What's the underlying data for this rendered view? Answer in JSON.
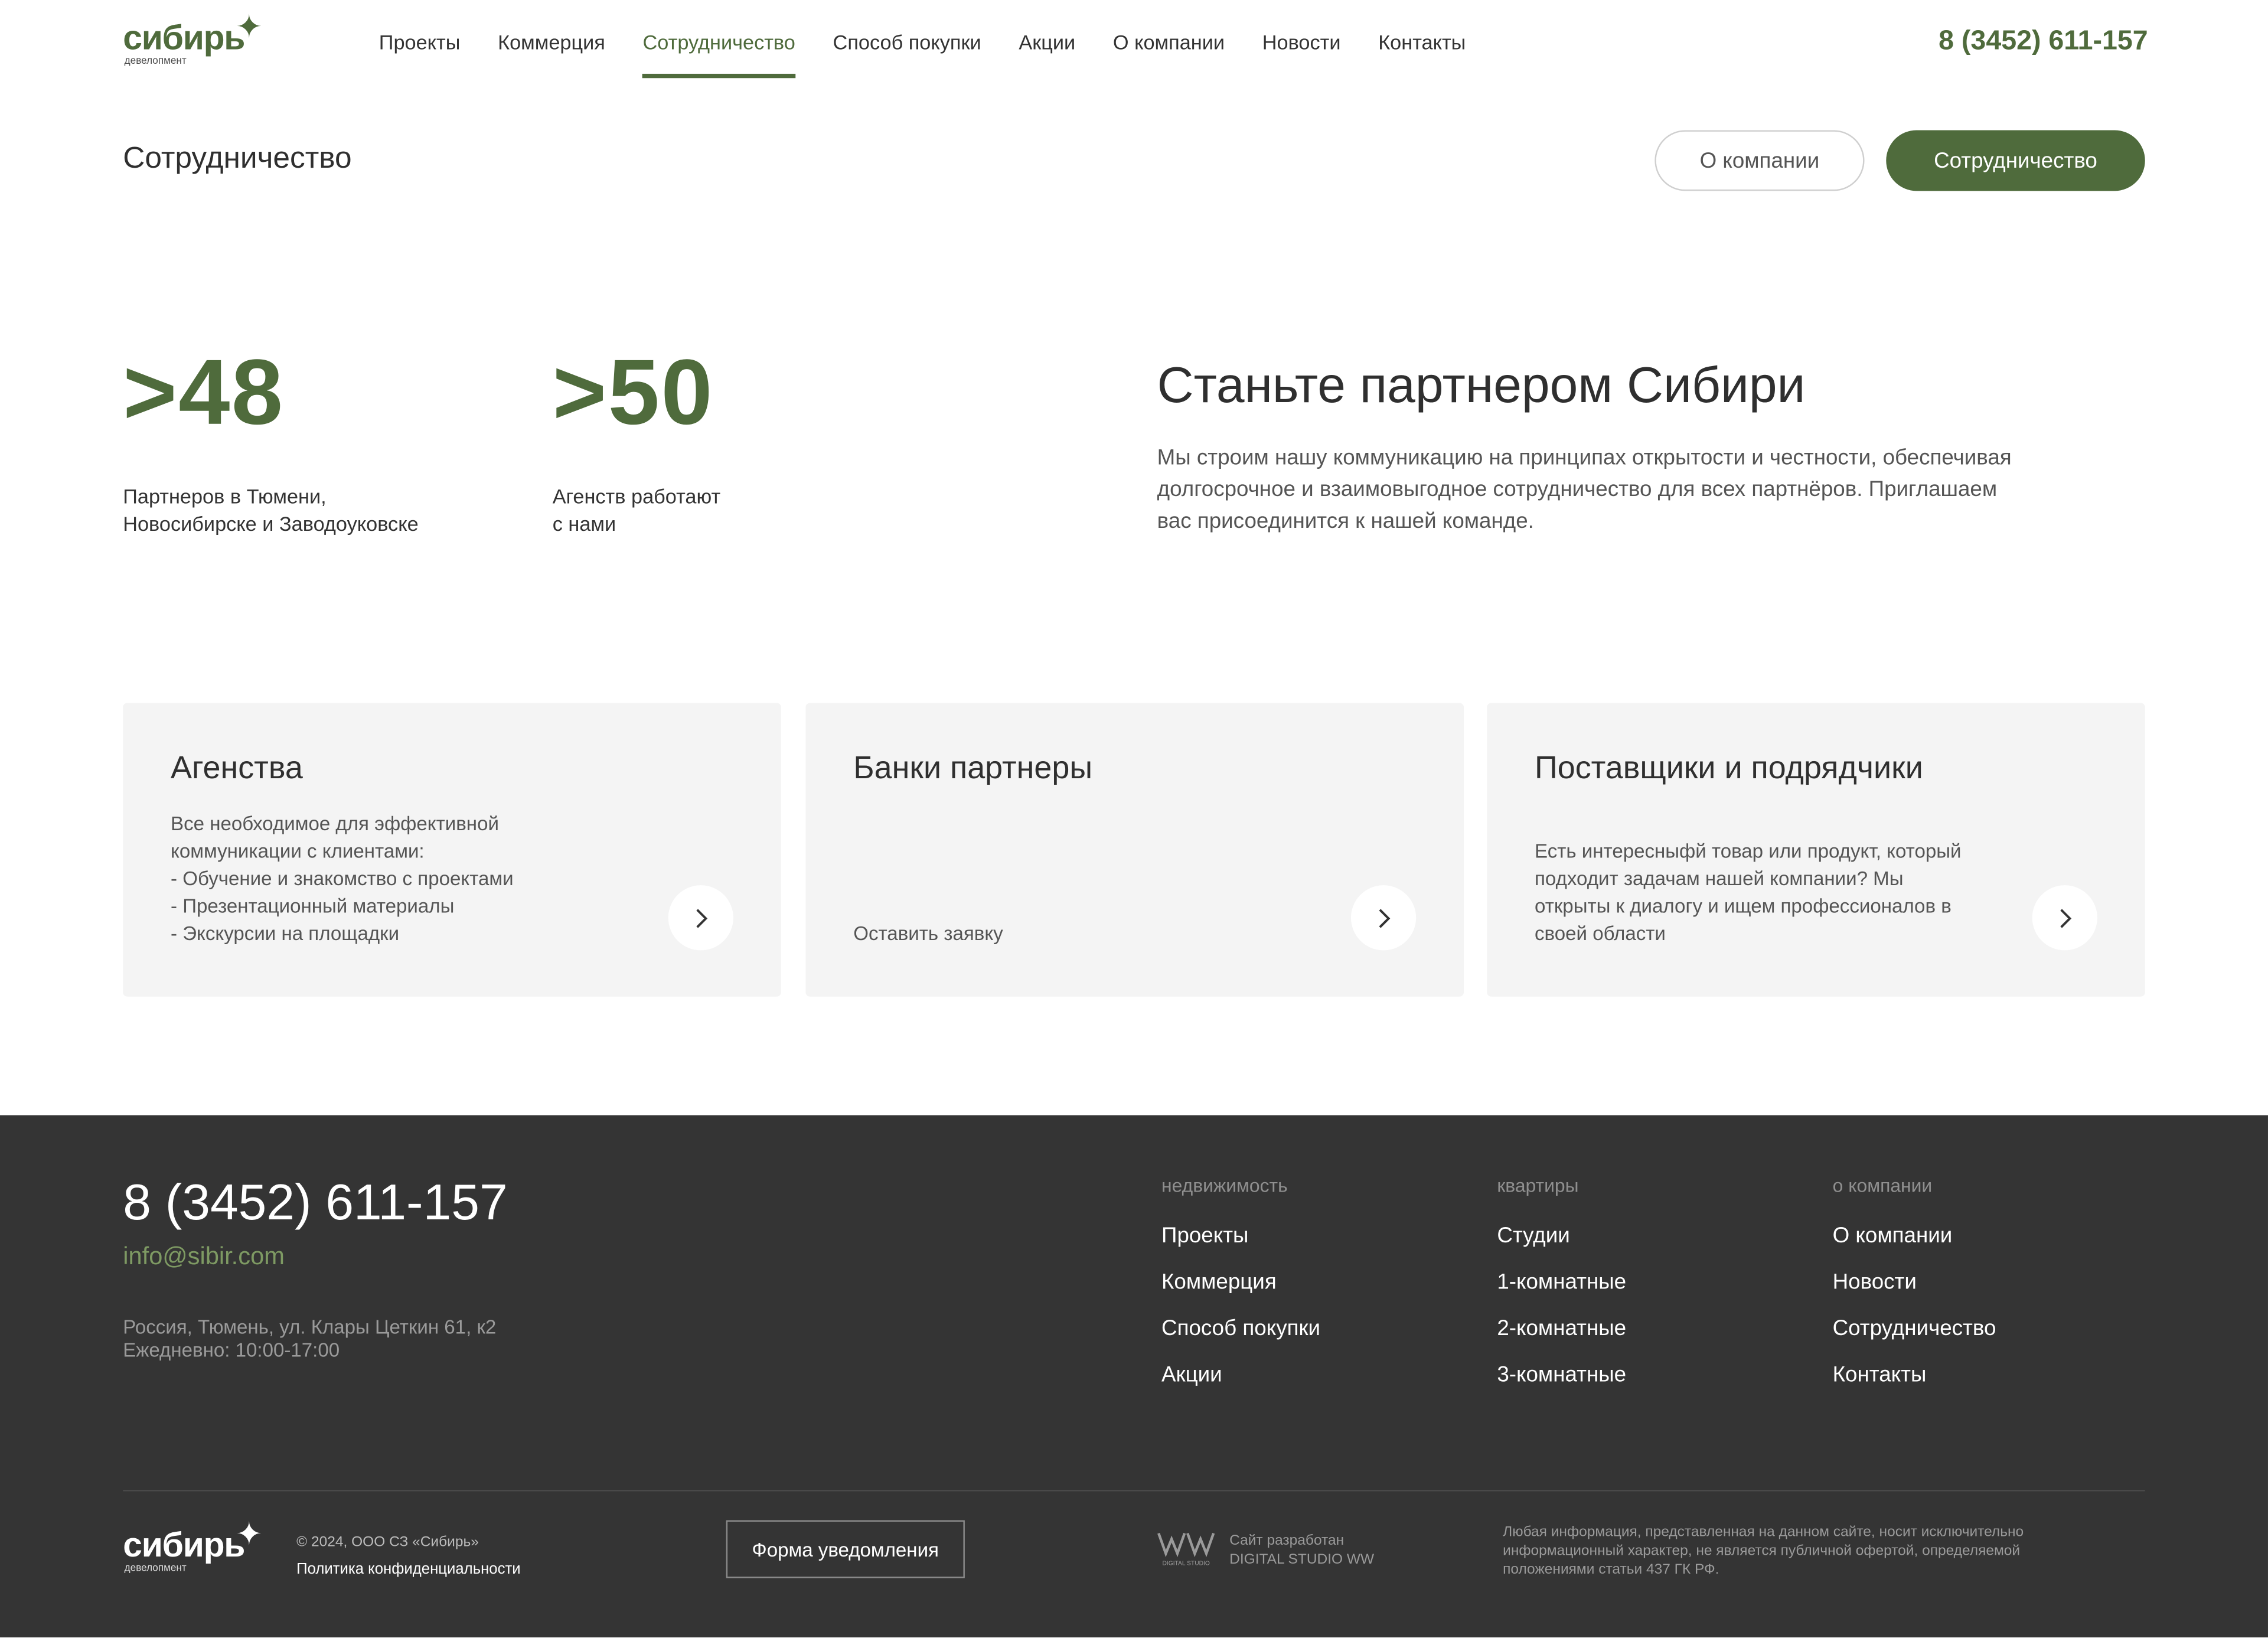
{
  "header": {
    "logo": {
      "word": "сибирь",
      "sub": "девелопмент"
    },
    "nav": [
      {
        "label": "Проекты"
      },
      {
        "label": "Коммерция"
      },
      {
        "label": "Сотрудничество",
        "active": true
      },
      {
        "label": "Способ покупки"
      },
      {
        "label": "Акции"
      },
      {
        "label": "О компании"
      },
      {
        "label": "Новости"
      },
      {
        "label": "Контакты"
      }
    ],
    "phone": "8 (3452) 611-157"
  },
  "page": {
    "title": "Сотрудничество",
    "tab_about": "О компании",
    "tab_partnership": "Сотрудничество"
  },
  "stats": [
    {
      "value": ">48",
      "label_lines": [
        "Партнеров в Тюмени,",
        "Новосибирске и Заводоуковске"
      ]
    },
    {
      "value": ">50",
      "label_lines": [
        "Агенств работают",
        "с нами"
      ]
    }
  ],
  "partner": {
    "title": "Станьте партнером Сибири",
    "text_lines": [
      "Мы строим нашу коммуникацию на принципах открытости и честности, обеспечивая",
      "долгосрочное и взаимовыгодное сотрудничество для всех партнёров. Приглашаем",
      "вас присоединится к нашей команде."
    ]
  },
  "cards": [
    {
      "title": "Агенства",
      "lines": [
        "Все необходимое для эффективной",
        "коммуникации с клиентами:",
        "- Обучение и знакомство с проектами",
        "- Презентационный материалы",
        "- Экскурсии на площадки"
      ]
    },
    {
      "title": "Банки партнеры",
      "lines": [
        "Оставить заявку"
      ]
    },
    {
      "title": "Поставщики и подрядчики",
      "lines": [
        "Есть интересныфй товар или продукт, который",
        "подходит задачам нашей компании? Мы",
        "открыты к диалогу и ищем профессионалов в",
        "своей области"
      ]
    }
  ],
  "footer": {
    "phone": "8 (3452) 611-157",
    "email": "info@sibir.com",
    "address_lines": [
      "Россия, Тюмень, ул. Клары Цеткин 61, к2",
      "Ежедневно: 10:00-17:00"
    ],
    "columns": [
      {
        "heading": "недвижимость",
        "links": [
          "Проекты",
          "Коммерция",
          "Способ покупки",
          "Акции"
        ]
      },
      {
        "heading": "квартиры",
        "links": [
          "Студии",
          "1-комнатные",
          "2-комнатные",
          "3-комнатные"
        ]
      },
      {
        "heading": "о компании",
        "links": [
          "О компании",
          "Новости",
          "Сотрудничество",
          "Контакты"
        ]
      }
    ],
    "copyright": "© 2024, ООО СЗ «Сибирь»",
    "policy": "Политика конфиденциальности",
    "form_button": "Форма уведомления",
    "studio_logo_caption": "DIGITAL STUDIO",
    "studio_lines": [
      "Сайт разработан",
      "DIGITAL STUDIO WW"
    ],
    "legal_lines": [
      "Любая информация, представленная на данном сайте, носит исключительно",
      "информационный характер, не является публичной офертой, определяемой",
      "положениями статьи 437 ГК РФ."
    ]
  },
  "colors": {
    "accent": "#4f6b3c",
    "footer_bg": "#343434",
    "card_bg": "#f4f4f4",
    "email": "#7e9a63"
  }
}
